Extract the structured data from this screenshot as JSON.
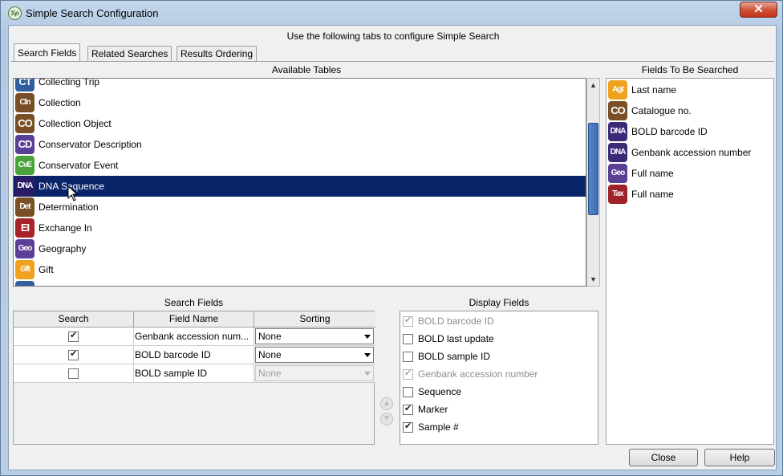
{
  "window": {
    "title": "Simple Search Configuration",
    "app_icon_text": "Sp"
  },
  "header": {
    "instruction": "Use the following tabs to configure Simple Search"
  },
  "tabs": [
    {
      "label": "Search Fields",
      "active": true
    },
    {
      "label": "Related Searches",
      "active": false
    },
    {
      "label": "Results Ordering",
      "active": false
    }
  ],
  "available_tables": {
    "heading": "Available Tables",
    "items": [
      {
        "label": "Collecting Trip",
        "icon": "CT",
        "color": "#2f5f9e"
      },
      {
        "label": "Collection",
        "icon": "Cln",
        "color": "#7a4f28"
      },
      {
        "label": "Collection Object",
        "icon": "CO",
        "color": "#7a4f28"
      },
      {
        "label": "Conservator Description",
        "icon": "CD",
        "color": "#5b3f94"
      },
      {
        "label": "Conservator Event",
        "icon": "CvE",
        "color": "#4aa33a"
      },
      {
        "label": "DNA Sequence",
        "icon": "DNA",
        "color": "#2b1d63",
        "selected": true
      },
      {
        "label": "Determination",
        "icon": "Det",
        "color": "#7a4f28"
      },
      {
        "label": "Exchange In",
        "icon": "EI",
        "color": "#a8242a"
      },
      {
        "label": "Geography",
        "icon": "Geo",
        "color": "#5b3f94"
      },
      {
        "label": "Gift",
        "icon": "Gft",
        "color": "#f0a21e"
      },
      {
        "label": "L",
        "icon": "L",
        "color": "#2f5f9e"
      }
    ]
  },
  "fields_to_search": {
    "heading": "Fields To Be Searched",
    "items": [
      {
        "label": "Last name",
        "icon": "Agt",
        "color": "#f0a21e"
      },
      {
        "label": "Catalogue no.",
        "icon": "CO",
        "color": "#7a4f28"
      },
      {
        "label": "BOLD barcode ID",
        "icon": "DNA",
        "color": "#3a2a78"
      },
      {
        "label": "Genbank accession number",
        "icon": "DNA",
        "color": "#3a2a78"
      },
      {
        "label": "Full name",
        "icon": "Geo",
        "color": "#5b3f94"
      },
      {
        "label": "Full name",
        "icon": "Tax",
        "color": "#9e2328"
      }
    ]
  },
  "search_fields": {
    "heading": "Search Fields",
    "columns": [
      "Search",
      "Field Name",
      "Sorting"
    ],
    "rows": [
      {
        "search": true,
        "field": "Genbank accession num...",
        "sorting": "None",
        "enabled": true
      },
      {
        "search": true,
        "field": "BOLD barcode ID",
        "sorting": "None",
        "enabled": true
      },
      {
        "search": false,
        "field": "BOLD sample ID",
        "sorting": "None",
        "enabled": false
      }
    ]
  },
  "display_fields": {
    "heading": "Display Fields",
    "items": [
      {
        "label": "BOLD barcode ID",
        "checked": true,
        "disabled": true
      },
      {
        "label": "BOLD last update",
        "checked": false,
        "disabled": false
      },
      {
        "label": "BOLD sample ID",
        "checked": false,
        "disabled": false
      },
      {
        "label": "Genbank accession number",
        "checked": true,
        "disabled": true
      },
      {
        "label": "Sequence",
        "checked": false,
        "disabled": false
      },
      {
        "label": "Marker",
        "checked": true,
        "disabled": false
      },
      {
        "label": "Sample #",
        "checked": true,
        "disabled": false
      }
    ]
  },
  "buttons": {
    "close": "Close",
    "help": "Help",
    "window_close": "✕"
  }
}
